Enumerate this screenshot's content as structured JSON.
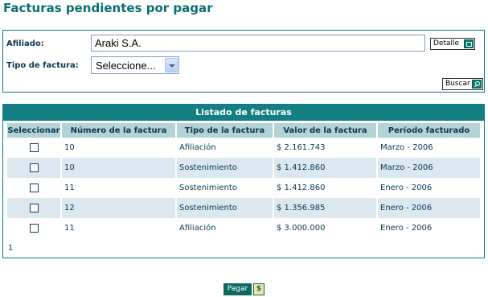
{
  "page": {
    "title": "Facturas pendientes por pagar"
  },
  "form": {
    "afiliado_label": "Afiliado:",
    "afiliado_value": "Araki S.A.",
    "detalle_label": "Detalle",
    "tipo_label": "Tipo de factura:",
    "tipo_selected": "Seleccione...",
    "buscar_label": "Buscar"
  },
  "list": {
    "title": "Listado de facturas",
    "columns": [
      "Seleccionar",
      "Número de la factura",
      "Tipo de la factura",
      "Valor de la factura",
      "Período facturado"
    ],
    "rows": [
      {
        "numero": "10",
        "tipo": "Afiliación",
        "valor": "$ 2.161.743",
        "periodo": "Marzo - 2006"
      },
      {
        "numero": "10",
        "tipo": "Sostenimiento",
        "valor": "$ 1.412.860",
        "periodo": "Marzo - 2006"
      },
      {
        "numero": "11",
        "tipo": "Sostenimiento",
        "valor": "$ 1.412.860",
        "periodo": "Enero - 2006"
      },
      {
        "numero": "12",
        "tipo": "Sostenimiento",
        "valor": "$ 1.356.985",
        "periodo": "Enero - 2006"
      },
      {
        "numero": "11",
        "tipo": "Afiliación",
        "valor": "$ 3.000.000",
        "periodo": "Enero - 2006"
      }
    ],
    "page_number": "1"
  },
  "actions": {
    "pagar_label": "Pagar",
    "pagar_icon_glyph": "$"
  },
  "colors": {
    "accent": "#0b6f73",
    "header_bg": "#137f82",
    "column_header_bg": "#b3d3d4",
    "alt_row_bg": "#dce8f0"
  }
}
